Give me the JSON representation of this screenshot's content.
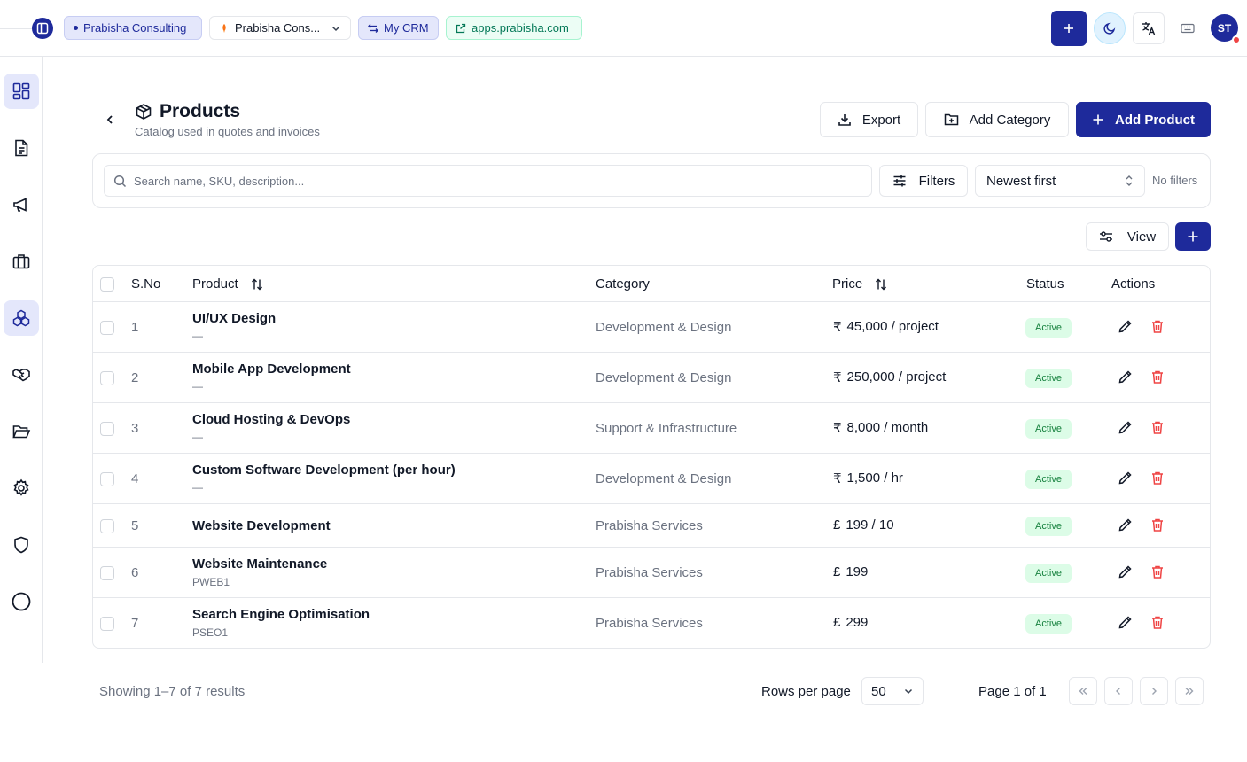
{
  "topbar": {
    "org_chip": "Prabisha Consulting",
    "org_select": "Prabisha Cons...",
    "crm_chip": "My CRM",
    "site_chip": "apps.prabisha.com",
    "avatar_initials": "ST"
  },
  "sidebar": {
    "items": [
      {
        "name": "dashboard",
        "icon": "dashboard-icon",
        "active": false
      },
      {
        "name": "documents",
        "icon": "document-icon",
        "active": false
      },
      {
        "name": "campaigns",
        "icon": "megaphone-icon",
        "active": false
      },
      {
        "name": "jobs",
        "icon": "briefcase-icon",
        "active": false
      },
      {
        "name": "products",
        "icon": "boxes-icon",
        "active": true
      },
      {
        "name": "deals",
        "icon": "handshake-icon",
        "active": false
      },
      {
        "name": "files",
        "icon": "folder-icon",
        "active": false
      },
      {
        "name": "settings",
        "icon": "gear-icon",
        "active": false
      },
      {
        "name": "security",
        "icon": "shield-icon",
        "active": false
      },
      {
        "name": "profile",
        "icon": "circle-icon",
        "active": false
      }
    ]
  },
  "header": {
    "title": "Products",
    "subtitle": "Catalog used in quotes and invoices",
    "export_label": "Export",
    "add_category_label": "Add Category",
    "add_product_label": "Add Product"
  },
  "toolbar": {
    "search_placeholder": "Search name, SKU, description...",
    "search_value": "",
    "filters_label": "Filters",
    "sort_value": "Newest first",
    "filters_status": "No filters",
    "view_label": "View"
  },
  "table": {
    "headers": {
      "sno": "S.No",
      "product": "Product",
      "category": "Category",
      "price": "Price",
      "status": "Status",
      "actions": "Actions"
    },
    "rows": [
      {
        "sno": "1",
        "name": "UI/UX Design",
        "sub": "—",
        "category": "Development & Design",
        "currency": "₹",
        "price": "45,000 / project",
        "status": "Active"
      },
      {
        "sno": "2",
        "name": "Mobile App Development",
        "sub": "—",
        "category": "Development & Design",
        "currency": "₹",
        "price": "250,000 / project",
        "status": "Active"
      },
      {
        "sno": "3",
        "name": "Cloud Hosting & DevOps",
        "sub": "—",
        "category": "Support & Infrastructure",
        "currency": "₹",
        "price": "8,000 / month",
        "status": "Active"
      },
      {
        "sno": "4",
        "name": "Custom Software Development (per hour)",
        "sub": "—",
        "category": "Development & Design",
        "currency": "₹",
        "price": "1,500 / hr",
        "status": "Active"
      },
      {
        "sno": "5",
        "name": "Website Development",
        "sub": "",
        "category": "Prabisha Services",
        "currency": "£",
        "price": "199 / 10",
        "status": "Active"
      },
      {
        "sno": "6",
        "name": "Website Maintenance",
        "sub": "PWEB1",
        "category": "Prabisha Services",
        "currency": "£",
        "price": "199",
        "status": "Active"
      },
      {
        "sno": "7",
        "name": "Search Engine Optimisation",
        "sub": "PSEO1",
        "category": "Prabisha Services",
        "currency": "£",
        "price": "299",
        "status": "Active"
      }
    ]
  },
  "footer": {
    "showing": "Showing 1–7 of 7 results",
    "rows_per_page_label": "Rows per page",
    "rows_per_page_value": "50",
    "page_label": "Page 1 of 1"
  },
  "colors": {
    "primary": "#1e2a9b",
    "danger": "#ef4444",
    "success_bg": "#dcfce7",
    "success_text": "#15803d"
  }
}
